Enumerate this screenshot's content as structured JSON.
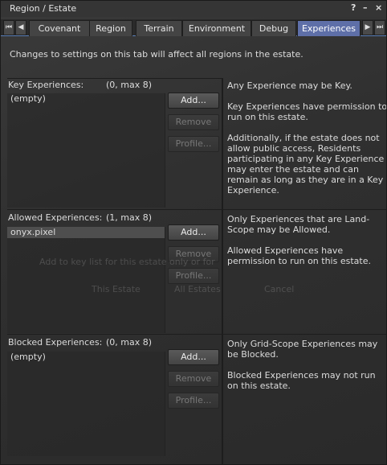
{
  "window": {
    "title": "Region / Estate",
    "help_glyph": "?",
    "minimize_glyph": "–",
    "close_glyph": "×"
  },
  "tabs": {
    "scroll_first": "⏮",
    "scroll_left": "◀",
    "scroll_right": "▶",
    "scroll_last": "⏭",
    "items": [
      {
        "label": "Covenant"
      },
      {
        "label": "Region"
      },
      {
        "label": "Terrain"
      },
      {
        "label": "Environment"
      },
      {
        "label": "Debug"
      },
      {
        "label": "Experiences"
      }
    ],
    "active": "Experiences"
  },
  "intro_text": "Changes to settings on this tab will affect all regions in the estate.",
  "key": {
    "label": "Key Experiences:",
    "count": "(0, max 8)",
    "items": [
      "(empty)"
    ],
    "add_label": "Add...",
    "remove_label": "Remove",
    "profile_label": "Profile...",
    "desc": [
      "Any Experience may be Key.",
      "Key Experiences have permission to run on this estate.",
      "Additionally, if the estate does not allow public access, Residents participating in any Key Experience may enter the estate and can remain as long as they are in a Key Experience."
    ]
  },
  "allowed": {
    "label": "Allowed Experiences:",
    "count": "(1, max 8)",
    "items": [
      "onyx.pixel"
    ],
    "add_label": "Add...",
    "remove_label": "Remove",
    "profile_label": "Profile...",
    "desc": [
      "Only Experiences that are Land-Scope may be Allowed.",
      "Allowed Experiences have permission to run on this estate."
    ]
  },
  "blocked": {
    "label": "Blocked Experiences:",
    "count": "(0, max 8)",
    "items": [
      "(empty)"
    ],
    "add_label": "Add...",
    "remove_label": "Remove",
    "profile_label": "Profile...",
    "desc": [
      "Only Grid-Scope Experiences may be Blocked.",
      "Blocked Experiences may not run on this estate."
    ]
  },
  "ghost_dialog": {
    "text": "Add to key list for this estate only or for",
    "this_estate": "This Estate",
    "all_estates": "All Estates",
    "cancel": "Cancel"
  }
}
